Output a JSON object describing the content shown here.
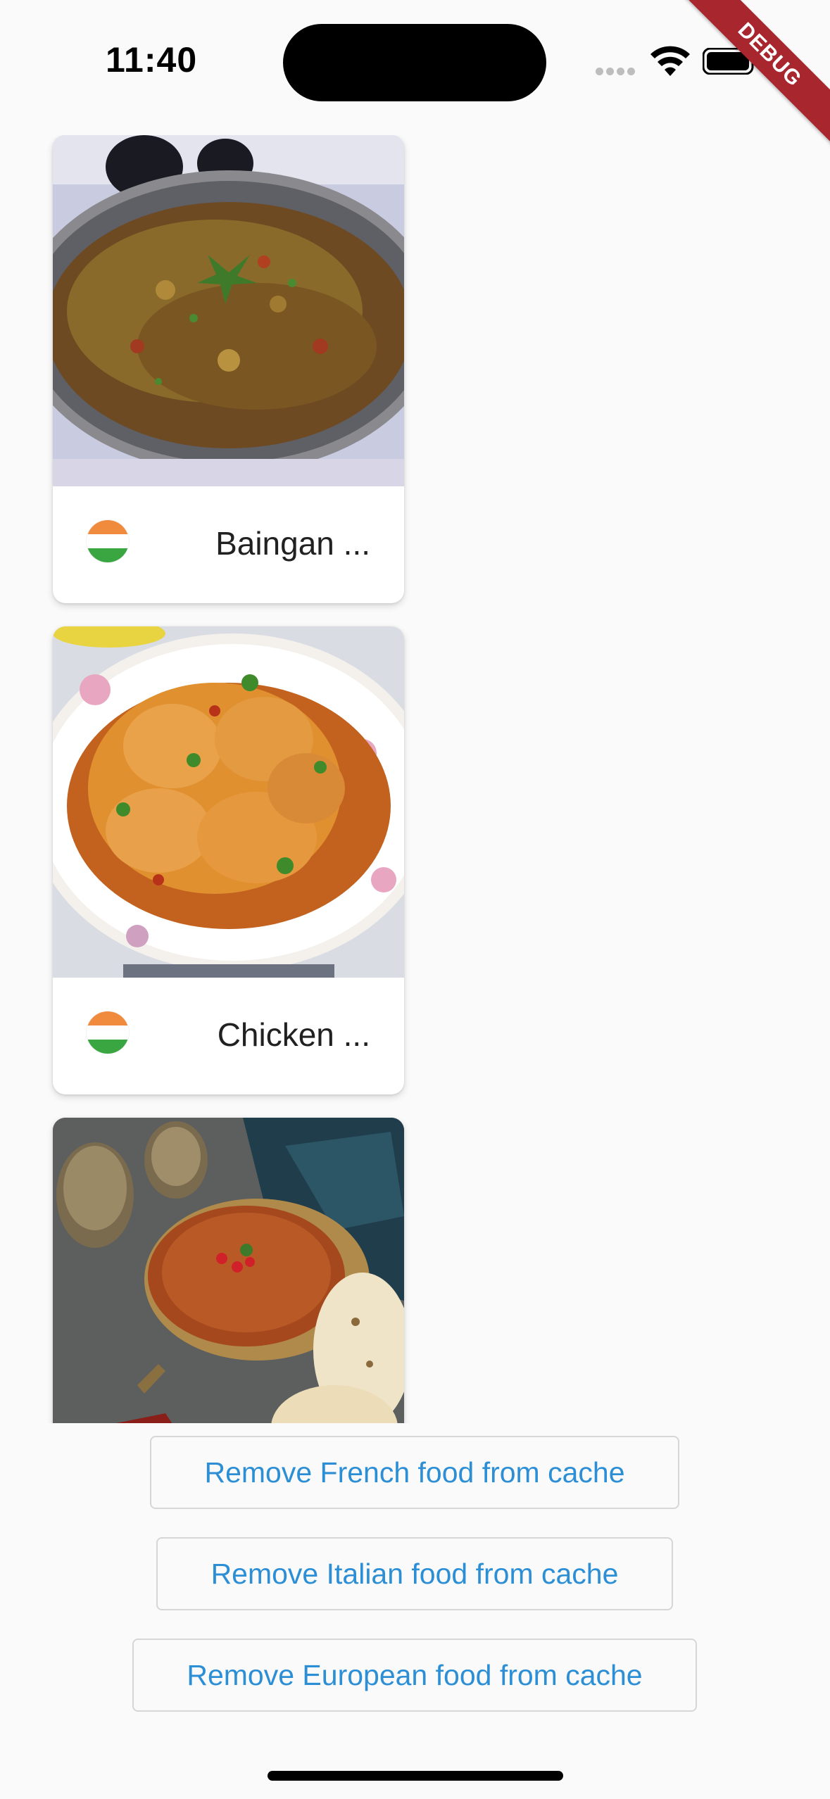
{
  "status_bar": {
    "time": "11:40"
  },
  "debug_banner": {
    "label": "DEBUG"
  },
  "cards": [
    {
      "name": "Baingan ...",
      "flag": "india-flag-icon",
      "photo": "baingan-bharta-photo"
    },
    {
      "name": "Chicken ...",
      "flag": "india-flag-icon",
      "photo": "chicken-curry-photo"
    },
    {
      "name": "",
      "flag": "",
      "photo": "dal-curry-photo"
    }
  ],
  "buttons": {
    "remove_french": "Remove French food from cache",
    "remove_italian": "Remove Italian food from cache",
    "remove_european": "Remove European food from cache"
  },
  "colors": {
    "accent": "#2c8fd6",
    "background": "#fafafa",
    "debug": "#a8262e"
  }
}
